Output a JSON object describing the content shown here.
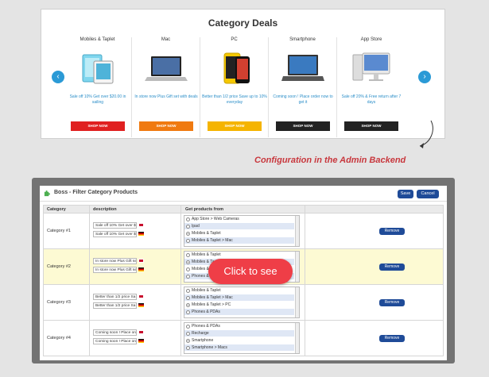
{
  "deals": {
    "title": "Category Deals",
    "prev_arrow": "‹",
    "next_arrow": "›",
    "categories": [
      {
        "name": "Mobiles & Taplet",
        "promo": "Sale off 10% Get over $20.00 in sailing",
        "button": "SHOP NOW",
        "button_color": "#e02020"
      },
      {
        "name": "Mac",
        "promo": "In store now Plus Gift set with deals",
        "button": "SHOP NOW",
        "button_color": "#f07a10"
      },
      {
        "name": "PC",
        "promo": "Better than 1/2 price Save up to 10% everyday",
        "button": "SHOP NOW",
        "button_color": "#f5b400"
      },
      {
        "name": "Smartphone",
        "promo": "Coming soon ! Place order now to get it",
        "button": "SHOP NOW",
        "button_color": "#222222"
      },
      {
        "name": "App Store",
        "promo": "Sale off 20% & Free return after 7 days",
        "button": "SHOP NOW",
        "button_color": "#222222"
      }
    ]
  },
  "config_label": "Configuration in the Admin Backend",
  "admin": {
    "title": "Boss - Filter Category Products",
    "save_label": "Save",
    "cancel_label": "Cancel",
    "columns": {
      "category": "Category",
      "description": "description",
      "products": "Get products from"
    },
    "rows": [
      {
        "label": "Category #1",
        "desc_en": "Sale off 10% Get over $",
        "desc_de": "Sale off 10% Get over $",
        "options": [
          {
            "text": "App Store > Web Cameras",
            "checked": false
          },
          {
            "text": "Ipad",
            "checked": false
          },
          {
            "text": "Mobiles & Taplet",
            "checked": true
          },
          {
            "text": "Mobiles & Taplet > Mac",
            "checked": false
          }
        ],
        "remove_label": "Remove"
      },
      {
        "label": "Category #2",
        "desc_en": "In store now Plus Gift se",
        "desc_de": "In store now Plus Gift se",
        "options": [
          {
            "text": "Mobiles & Taplet",
            "checked": false
          },
          {
            "text": "Mobiles & Taplet > Mac",
            "checked": true
          },
          {
            "text": "Mobiles & Taplet > PC",
            "checked": false
          },
          {
            "text": "Phones & PDAs",
            "checked": false
          }
        ],
        "remove_label": "Remove"
      },
      {
        "label": "Category #3",
        "desc_en": "Better than 1/2 price Sa",
        "desc_de": "Better than 1/2 price Sa",
        "options": [
          {
            "text": "Mobiles & Taplet",
            "checked": false
          },
          {
            "text": "Mobiles & Taplet > Mac",
            "checked": false
          },
          {
            "text": "Mobiles & Taplet > PC",
            "checked": true
          },
          {
            "text": "Phones & PDAs",
            "checked": false
          }
        ],
        "remove_label": "Remove"
      },
      {
        "label": "Category #4",
        "desc_en": "Coming soon ! Place ord",
        "desc_de": "Coming soon ! Place ord",
        "options": [
          {
            "text": "Phones & PDAs",
            "checked": false
          },
          {
            "text": "Recharge",
            "checked": false
          },
          {
            "text": "Smartphone",
            "checked": true
          },
          {
            "text": "Smartphone > Macs",
            "checked": false
          }
        ],
        "remove_label": "Remove"
      }
    ]
  },
  "overlay_button": "Click to see"
}
